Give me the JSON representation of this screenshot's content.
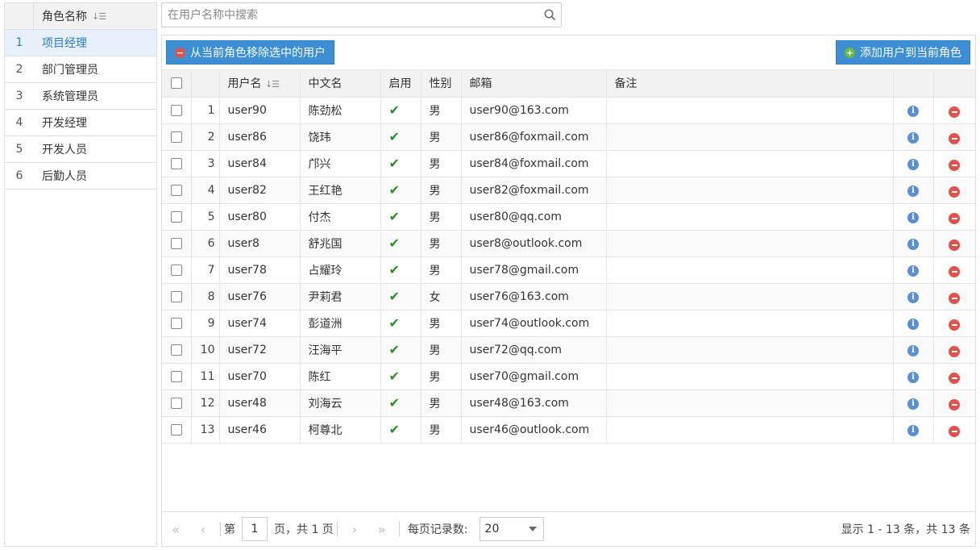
{
  "roles": {
    "header": "角色名称",
    "items": [
      {
        "num": "1",
        "label": "项目经理",
        "selected": true
      },
      {
        "num": "2",
        "label": "部门管理员"
      },
      {
        "num": "3",
        "label": "系统管理员"
      },
      {
        "num": "4",
        "label": "开发经理"
      },
      {
        "num": "5",
        "label": "开发人员"
      },
      {
        "num": "6",
        "label": "后勤人员"
      }
    ]
  },
  "search": {
    "placeholder": "在用户名称中搜索"
  },
  "toolbar": {
    "remove_label": "从当前角色移除选中的用户",
    "add_label": "添加用户到当前角色"
  },
  "table": {
    "columns": {
      "username": "用户名",
      "cname": "中文名",
      "enabled": "启用",
      "gender": "性别",
      "email": "邮箱",
      "remark": "备注"
    },
    "rows": [
      {
        "num": "1",
        "username": "user90",
        "cname": "陈劲松",
        "enabled": "✔",
        "gender": "男",
        "email": "user90@163.com",
        "remark": ""
      },
      {
        "num": "2",
        "username": "user86",
        "cname": "饶玮",
        "enabled": "✔",
        "gender": "男",
        "email": "user86@foxmail.com",
        "remark": ""
      },
      {
        "num": "3",
        "username": "user84",
        "cname": "邝兴",
        "enabled": "✔",
        "gender": "男",
        "email": "user84@foxmail.com",
        "remark": ""
      },
      {
        "num": "4",
        "username": "user82",
        "cname": "王红艳",
        "enabled": "✔",
        "gender": "男",
        "email": "user82@foxmail.com",
        "remark": ""
      },
      {
        "num": "5",
        "username": "user80",
        "cname": "付杰",
        "enabled": "✔",
        "gender": "男",
        "email": "user80@qq.com",
        "remark": ""
      },
      {
        "num": "6",
        "username": "user8",
        "cname": "舒兆国",
        "enabled": "✔",
        "gender": "男",
        "email": "user8@outlook.com",
        "remark": ""
      },
      {
        "num": "7",
        "username": "user78",
        "cname": "占耀玲",
        "enabled": "✔",
        "gender": "男",
        "email": "user78@gmail.com",
        "remark": ""
      },
      {
        "num": "8",
        "username": "user76",
        "cname": "尹莉君",
        "enabled": "✔",
        "gender": "女",
        "email": "user76@163.com",
        "remark": ""
      },
      {
        "num": "9",
        "username": "user74",
        "cname": "彭道洲",
        "enabled": "✔",
        "gender": "男",
        "email": "user74@outlook.com",
        "remark": ""
      },
      {
        "num": "10",
        "username": "user72",
        "cname": "汪海平",
        "enabled": "✔",
        "gender": "男",
        "email": "user72@qq.com",
        "remark": ""
      },
      {
        "num": "11",
        "username": "user70",
        "cname": "陈红",
        "enabled": "✔",
        "gender": "男",
        "email": "user70@gmail.com",
        "remark": ""
      },
      {
        "num": "12",
        "username": "user48",
        "cname": "刘海云",
        "enabled": "✔",
        "gender": "男",
        "email": "user48@163.com",
        "remark": ""
      },
      {
        "num": "13",
        "username": "user46",
        "cname": "柯尊北",
        "enabled": "✔",
        "gender": "男",
        "email": "user46@outlook.com",
        "remark": ""
      }
    ]
  },
  "pager": {
    "page_prefix": "第",
    "page_value": "1",
    "page_suffix": "页，共 1 页",
    "page_size_label": "每页记录数:",
    "page_size_value": "20",
    "info": "显示 1 - 13 条，共 13 条"
  },
  "colors": {
    "accent": "#3d8fd5",
    "selected_bg": "#e8f0fb",
    "selected_text": "#2b7bc9",
    "check": "#2e8b2e",
    "danger": "#e0524a",
    "info": "#5b8fd0"
  }
}
